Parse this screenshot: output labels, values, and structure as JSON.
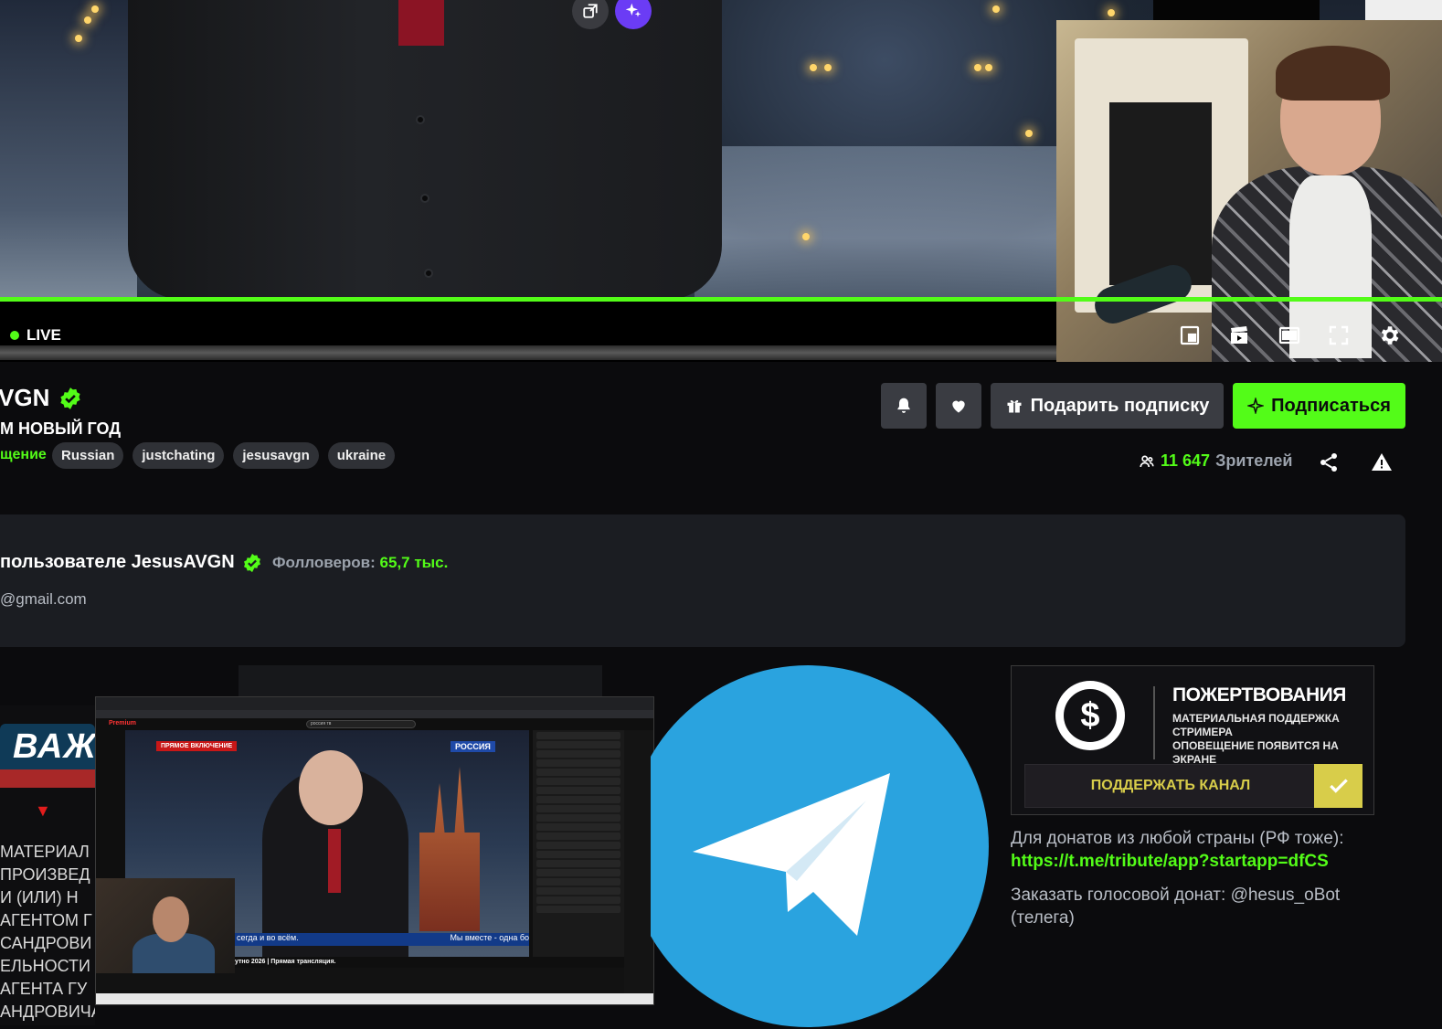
{
  "player": {
    "live_label": "LIVE"
  },
  "channel": {
    "name": "VGN",
    "stream_title": "M НОВЫЙ ГОД",
    "category": "щение",
    "tags": [
      "Russian",
      "justchating",
      "jesusavgn",
      "ukraine"
    ]
  },
  "actions": {
    "gift_label": "Подарить подписку",
    "subscribe_label": "Подписаться"
  },
  "viewers": {
    "count": "11 647",
    "label": "Зрителей"
  },
  "about": {
    "title": "пользователе JesusAVGN",
    "followers_label": "Фолловеров:",
    "followers_value": "65,7 тыс.",
    "email": "@gmail.com"
  },
  "panels": {
    "vazh_text": "ВАЖ",
    "vazh_lines": [
      "МАТЕРИАЛ",
      "ПРОИЗВЕД",
      "И (ИЛИ) Н",
      "АГЕНТОМ Г",
      "САНДРОВИ",
      "ЕЛЬНОСТИ",
      "АГЕНТА ГУ",
      "АНДРОВИЧА"
    ],
    "shot_live_badge": "ПРЯМОЕ ВКЛЮЧЕНИЕ",
    "shot_channel_badge": "РОССИЯ",
    "shot_subtitle_left": "сегда и во всём.",
    "shot_subtitle_right": "Мы вместе - одна бо",
    "shot_title": "утно 2026 | Прямая трансляция.",
    "shot_search": "россия тв",
    "shot_logo": "Premium"
  },
  "donate": {
    "title": "ПОЖЕРТВОВАНИЯ",
    "lines": [
      "МАТЕРИАЛЬНАЯ ПОДДЕРЖКА",
      "СТРИМЕРА",
      "ОПОВЕЩЕНИЕ ПОЯВИТСЯ НА ЭКРАНЕ"
    ],
    "button_label": "ПОДДЕРЖАТЬ КАНАЛ",
    "text1": "Для донатов из любой страны (РФ тоже):",
    "link": "https://t.me/tribute/app?startapp=dfCS",
    "text2": "Заказать голосовой донат: @hesus_oBot (телега)"
  },
  "colors": {
    "accent": "#53fc18",
    "background": "#0b0b0d",
    "panel": "#1b1d22",
    "button": "#3a3c42",
    "telegram": "#2aa3df",
    "donate_gold": "#d8cd4a"
  }
}
